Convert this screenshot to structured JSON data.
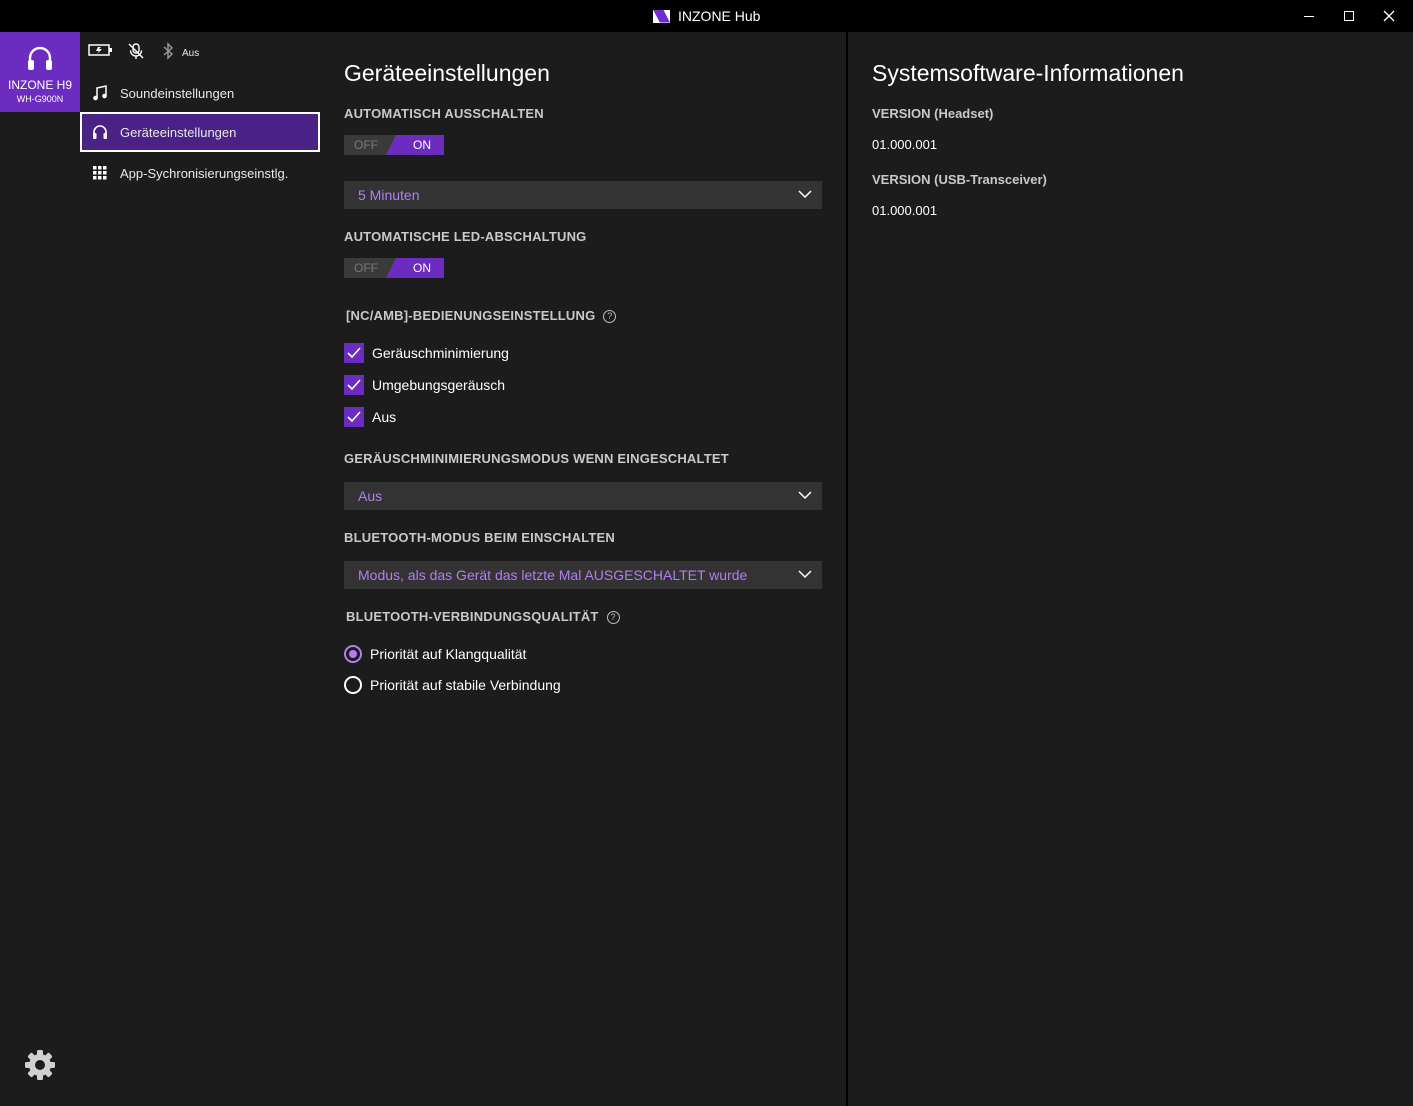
{
  "window": {
    "title": "INZONE Hub"
  },
  "device": {
    "name": "INZONE H9",
    "model": "WH-G900N"
  },
  "status": {
    "icons": [
      "battery-icon",
      "mic-muted-icon",
      "bluetooth-icon"
    ],
    "bluetooth_label": "Aus"
  },
  "nav": {
    "items": [
      {
        "label": "Soundeinstellungen",
        "icon": "music-note-icon"
      },
      {
        "label": "Geräteeinstellungen",
        "icon": "headphones-icon",
        "active": true
      },
      {
        "label": "App-Sychronisierungseinstlg.",
        "icon": "grid-icon"
      }
    ]
  },
  "main": {
    "title": "Geräteeinstellungen",
    "auto_off": {
      "label": "AUTOMATISCH AUSSCHALTEN",
      "off": "OFF",
      "on": "ON",
      "state": "ON",
      "select_value": "5 Minuten"
    },
    "led_off": {
      "label": "AUTOMATISCHE LED-ABSCHALTUNG",
      "off": "OFF",
      "on": "ON",
      "state": "ON"
    },
    "nc_amb": {
      "label": "[NC/AMB]-BEDIENUNGSEINSTELLUNG",
      "help": "?",
      "options": [
        {
          "label": "Geräuschminimierung",
          "checked": true
        },
        {
          "label": "Umgebungsgeräusch",
          "checked": true
        },
        {
          "label": "Aus",
          "checked": true
        }
      ]
    },
    "nc_mode": {
      "label": "GERÄUSCHMINIMIERUNGSMODUS WENN EINGESCHALTET",
      "select_value": "Aus"
    },
    "bt_mode": {
      "label": "BLUETOOTH-MODUS BEIM EINSCHALTEN",
      "select_value": "Modus, als das Gerät das letzte Mal AUSGESCHALTET wurde"
    },
    "bt_quality": {
      "label": "BLUETOOTH-VERBINDUNGSQUALITÄT",
      "help": "?",
      "options": [
        {
          "label": "Priorität auf Klangqualität",
          "selected": true
        },
        {
          "label": "Priorität auf stabile Verbindung",
          "selected": false
        }
      ]
    }
  },
  "system_info": {
    "title": "Systemsoftware-Informationen",
    "headset_label": "VERSION (Headset)",
    "headset_version": "01.000.001",
    "usb_label": "VERSION (USB-Transceiver)",
    "usb_version": "01.000.001"
  },
  "colors": {
    "accent": "#6c2cbf",
    "accent_text": "#b27ef2",
    "background": "#1c1c1c"
  }
}
